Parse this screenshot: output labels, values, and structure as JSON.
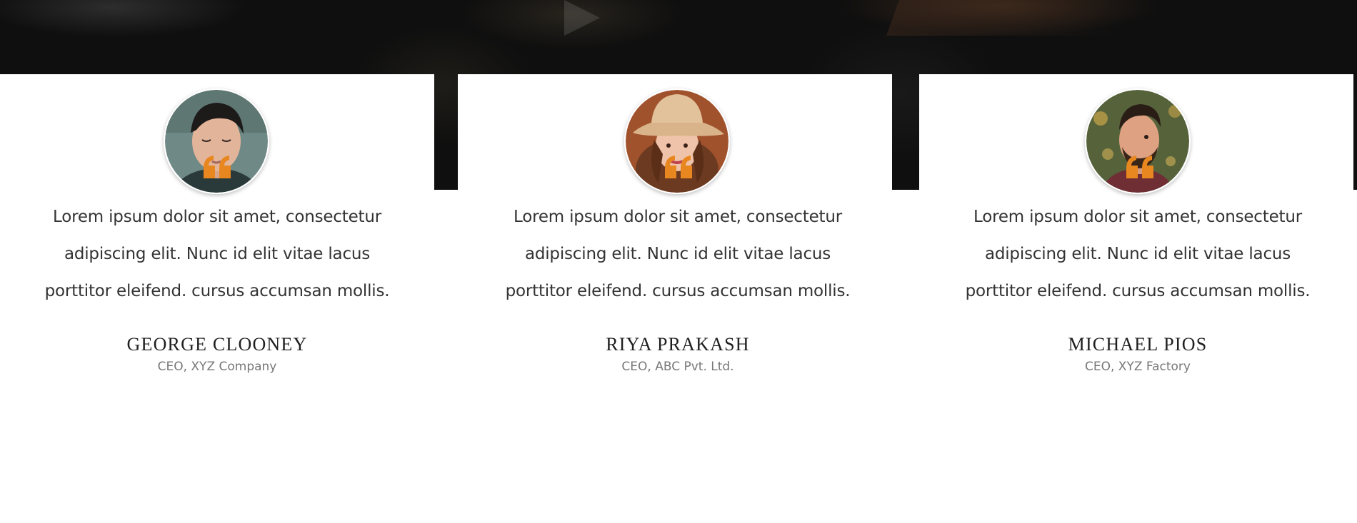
{
  "colors": {
    "accent": "#e8861f",
    "band": "#0f0f0f",
    "text": "#333333",
    "name": "#1f1f1f",
    "role": "#777777"
  },
  "testimonials": [
    {
      "avatar_icon": "person-portrait-man-eyes-closed",
      "quote_icon": "quote-icon",
      "text": "Lorem ipsum dolor sit amet, consectetur adipiscing elit. Nunc id elit vitae lacus porttitor eleifend. cursus accumsan mollis.",
      "name": "GEORGE CLOONEY",
      "role": "CEO, XYZ Company"
    },
    {
      "avatar_icon": "person-portrait-woman-hat",
      "quote_icon": "quote-icon",
      "text": "Lorem ipsum dolor sit amet, consectetur adipiscing elit. Nunc id elit vitae lacus porttitor eleifend. cursus accumsan mollis.",
      "name": "RIYA PRAKASH",
      "role": "CEO, ABC Pvt. Ltd."
    },
    {
      "avatar_icon": "person-portrait-man-beard",
      "quote_icon": "quote-icon",
      "text": "Lorem ipsum dolor sit amet, consectetur adipiscing elit. Nunc id elit vitae lacus porttitor eleifend. cursus accumsan mollis.",
      "name": "MICHAEL PIOS",
      "role": "CEO, XYZ Factory"
    }
  ]
}
